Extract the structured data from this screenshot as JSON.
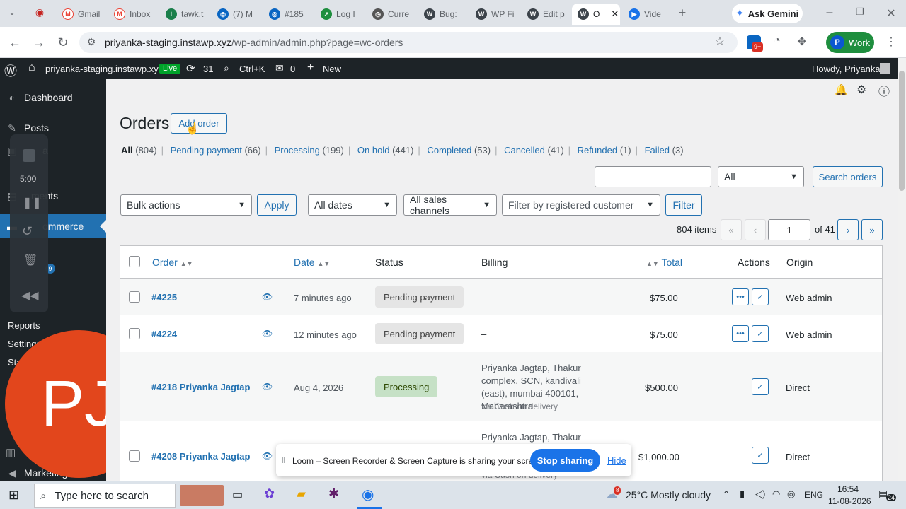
{
  "browser": {
    "tabs": [
      {
        "label": "Gmail",
        "icon": "gmail-icon",
        "color": "#ea4335"
      },
      {
        "label": "Inbox",
        "icon": "gmail-icon",
        "color": "#ea4335"
      },
      {
        "label": "tawk.t",
        "icon": "tawk-icon",
        "color": "#1a7f4b"
      },
      {
        "label": "(7) M",
        "icon": "messenger-icon",
        "color": "#0a66c2"
      },
      {
        "label": "#185",
        "icon": "messenger-icon",
        "color": "#0a66c2"
      },
      {
        "label": "Log I",
        "icon": "log-icon",
        "color": "#1e8e3e"
      },
      {
        "label": "Curre",
        "icon": "clock-icon",
        "color": "#444"
      },
      {
        "label": "Bug:",
        "icon": "wordpress-icon",
        "color": "#3c434a"
      },
      {
        "label": "WP Fi",
        "icon": "wordpress-icon",
        "color": "#3c434a"
      },
      {
        "label": "Edit p",
        "icon": "wordpress-icon",
        "color": "#3c434a"
      },
      {
        "label": "O",
        "icon": "wordpress-icon",
        "color": "#3c434a"
      },
      {
        "label": "Vide",
        "icon": "video-icon",
        "color": "#1a73e8"
      }
    ],
    "gemini_label": "Ask Gemini",
    "url_host": "priyanka-staging.instawp.xyz",
    "url_path": "/wp-admin/admin.php?page=wc-orders",
    "extension_badge": "9+",
    "profile_label": "Work",
    "profile_initial": "P"
  },
  "adminbar": {
    "site": "priyanka-staging.instawp.xyz",
    "live": "Live",
    "updates": "31",
    "search": "Ctrl+K",
    "comments": "0",
    "new": "New",
    "howdy": "Howdy, Priyanka"
  },
  "sidebar": {
    "dashboard": "Dashboard",
    "posts": "Posts",
    "media_partial": "a",
    "comments_partial": "ments",
    "woocommerce_partial": "ommerce",
    "badge": "9",
    "reports": "Reports",
    "settings": "Settings",
    "status_partial": "Sta",
    "marketing": "Marketing"
  },
  "loom_controls": {
    "timer": "5:00"
  },
  "avatar_initials": "PJ",
  "page": {
    "title": "Orders",
    "add_order": "Add order",
    "filters": [
      {
        "label": "All",
        "count": "(804)",
        "current": true
      },
      {
        "label": "Pending payment",
        "count": "(66)"
      },
      {
        "label": "Processing",
        "count": "(199)"
      },
      {
        "label": "On hold",
        "count": "(441)"
      },
      {
        "label": "Completed",
        "count": "(53)"
      },
      {
        "label": "Cancelled",
        "count": "(41)"
      },
      {
        "label": "Refunded",
        "count": "(1)"
      },
      {
        "label": "Failed",
        "count": "(3)"
      }
    ],
    "search_placeholder": "",
    "search_scope": "All",
    "search_button": "Search orders",
    "bulk_actions": "Bulk actions",
    "apply": "Apply",
    "all_dates": "All dates",
    "all_channels": "All sales channels",
    "customer_filter": "Filter by registered customer",
    "filter": "Filter",
    "items": "804 items",
    "first": "«",
    "prev": "‹",
    "current_page": "1",
    "of_pages": "of 41",
    "next": "›",
    "last": "»"
  },
  "table": {
    "headers": {
      "order": "Order",
      "date": "Date",
      "status": "Status",
      "billing": "Billing",
      "total": "Total",
      "actions": "Actions",
      "origin": "Origin"
    },
    "rows": [
      {
        "order": "#4225",
        "date": "7 minutes ago",
        "status": "Pending payment",
        "billing": "–",
        "billing_via": "",
        "total": "$75.00",
        "origin": "Web admin"
      },
      {
        "order": "#4224",
        "date": "12 minutes ago",
        "status": "Pending payment",
        "billing": "–",
        "billing_via": "",
        "total": "$75.00",
        "origin": "Web admin"
      },
      {
        "order": "#4218 Priyanka Jagtap",
        "date": "Aug 4, 2026",
        "status": "Processing",
        "billing": "Priyanka Jagtap, Thakur complex, SCN, kandivali (east), mumbai 400101, Maharashtra",
        "billing_via": "via Cash on delivery",
        "total": "$500.00",
        "origin": "Direct"
      },
      {
        "order": "#4208 Priyanka Jagtap",
        "date": "",
        "status": "",
        "billing": "Priyanka Jagtap, Thakur",
        "billing_via": "via Cash on delivery",
        "total": "$1,000.00",
        "origin": "Direct"
      }
    ]
  },
  "loom_bar": {
    "message": "Loom – Screen Recorder & Screen Capture is sharing your screen.",
    "stop": "Stop sharing",
    "hide": "Hide"
  },
  "taskbar": {
    "search_placeholder": "Type here to search",
    "weather_badge": "8",
    "weather": "25°C  Mostly cloudy",
    "lang": "ENG",
    "time": "16:54",
    "date": "11-08-2026",
    "notif": "24"
  }
}
